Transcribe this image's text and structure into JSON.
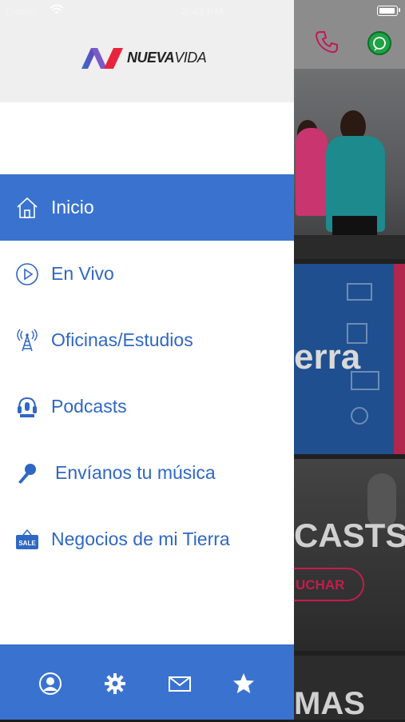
{
  "status_bar": {
    "carrier": "Carrier",
    "time": "3:43 PM"
  },
  "app": {
    "logo_text_bold": "NUEVA",
    "logo_text_light": "VIDA"
  },
  "menu": {
    "items": [
      {
        "label": "Inicio",
        "icon": "home-icon",
        "active": true
      },
      {
        "label": "En Vivo",
        "icon": "play-circle-icon",
        "active": false
      },
      {
        "label": "Oficinas/Estudios",
        "icon": "radio-tower-icon",
        "active": false
      },
      {
        "label": "Podcasts",
        "icon": "podcast-icon",
        "active": false
      },
      {
        "label": "Envíanos tu música",
        "icon": "microphone-icon",
        "active": false
      },
      {
        "label": "Negocios de mi Tierra",
        "icon": "sale-sign-icon",
        "active": false
      }
    ]
  },
  "footer": {
    "buttons": [
      {
        "name": "profile",
        "icon": "user-circle-icon"
      },
      {
        "name": "settings",
        "icon": "gear-icon"
      },
      {
        "name": "contact",
        "icon": "mail-icon"
      },
      {
        "name": "favorites",
        "icon": "star-icon"
      }
    ]
  },
  "background_cards": {
    "card2_word": "erra",
    "card3_word": "CASTS",
    "card3_button": "UCHAR",
    "card4_word": "MAS"
  },
  "colors": {
    "accent": "#3a73cf",
    "menu_text": "#2f67c4",
    "header_bg": "#efefef"
  }
}
